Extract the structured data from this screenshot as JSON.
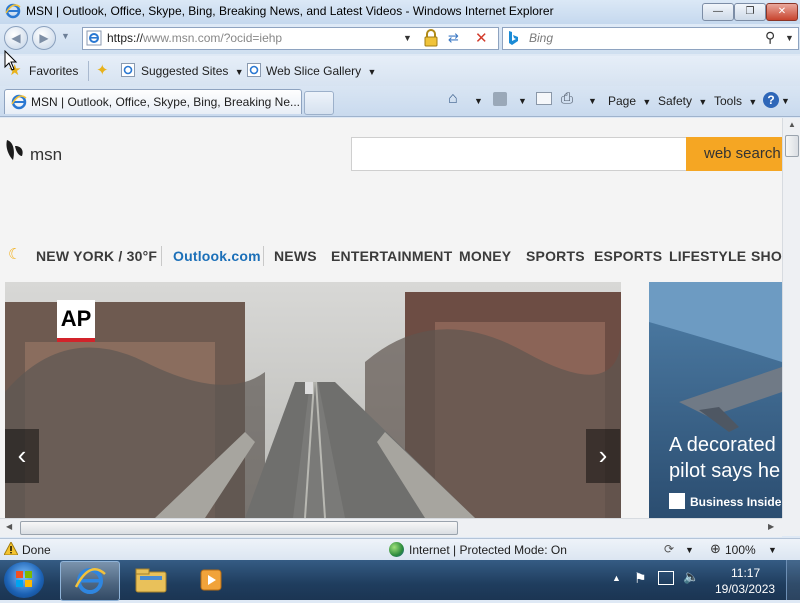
{
  "window": {
    "title": "MSN | Outlook, Office, Skype, Bing, Breaking News, and Latest Videos - Windows Internet Explorer"
  },
  "address": {
    "url_prefix": "https://",
    "url_domain": "www.msn.com",
    "url_path": "/?ocid=iehp"
  },
  "search": {
    "placeholder": "Bing"
  },
  "favorites": {
    "label": "Favorites",
    "items": [
      "Suggested Sites",
      "Web Slice Gallery"
    ]
  },
  "tab": {
    "title": "MSN | Outlook, Office, Skype, Bing, Breaking Ne..."
  },
  "commands": {
    "page": "Page",
    "safety": "Safety",
    "tools": "Tools"
  },
  "msn": {
    "logo_text": "msn",
    "search_button": "web search",
    "nav": [
      "NEW YORK / 30°F",
      "Outlook.com",
      "NEWS",
      "ENTERTAINMENT",
      "MONEY",
      "SPORTS",
      "ESPORTS",
      "LIFESTYLE",
      "SHO"
    ],
    "hero": {
      "badge": "AP"
    },
    "side_card": {
      "headline_line1": "A decorated",
      "headline_line2": "pilot says he",
      "source": "Business Insider"
    }
  },
  "status": {
    "text": "Done",
    "zone": "Internet | Protected Mode: On",
    "zoom": "100%"
  },
  "taskbar": {
    "time": "11:17",
    "date": "19/03/2023"
  },
  "colors": {
    "accent": "#f5a623",
    "outlook_link": "#1b6fb8"
  }
}
